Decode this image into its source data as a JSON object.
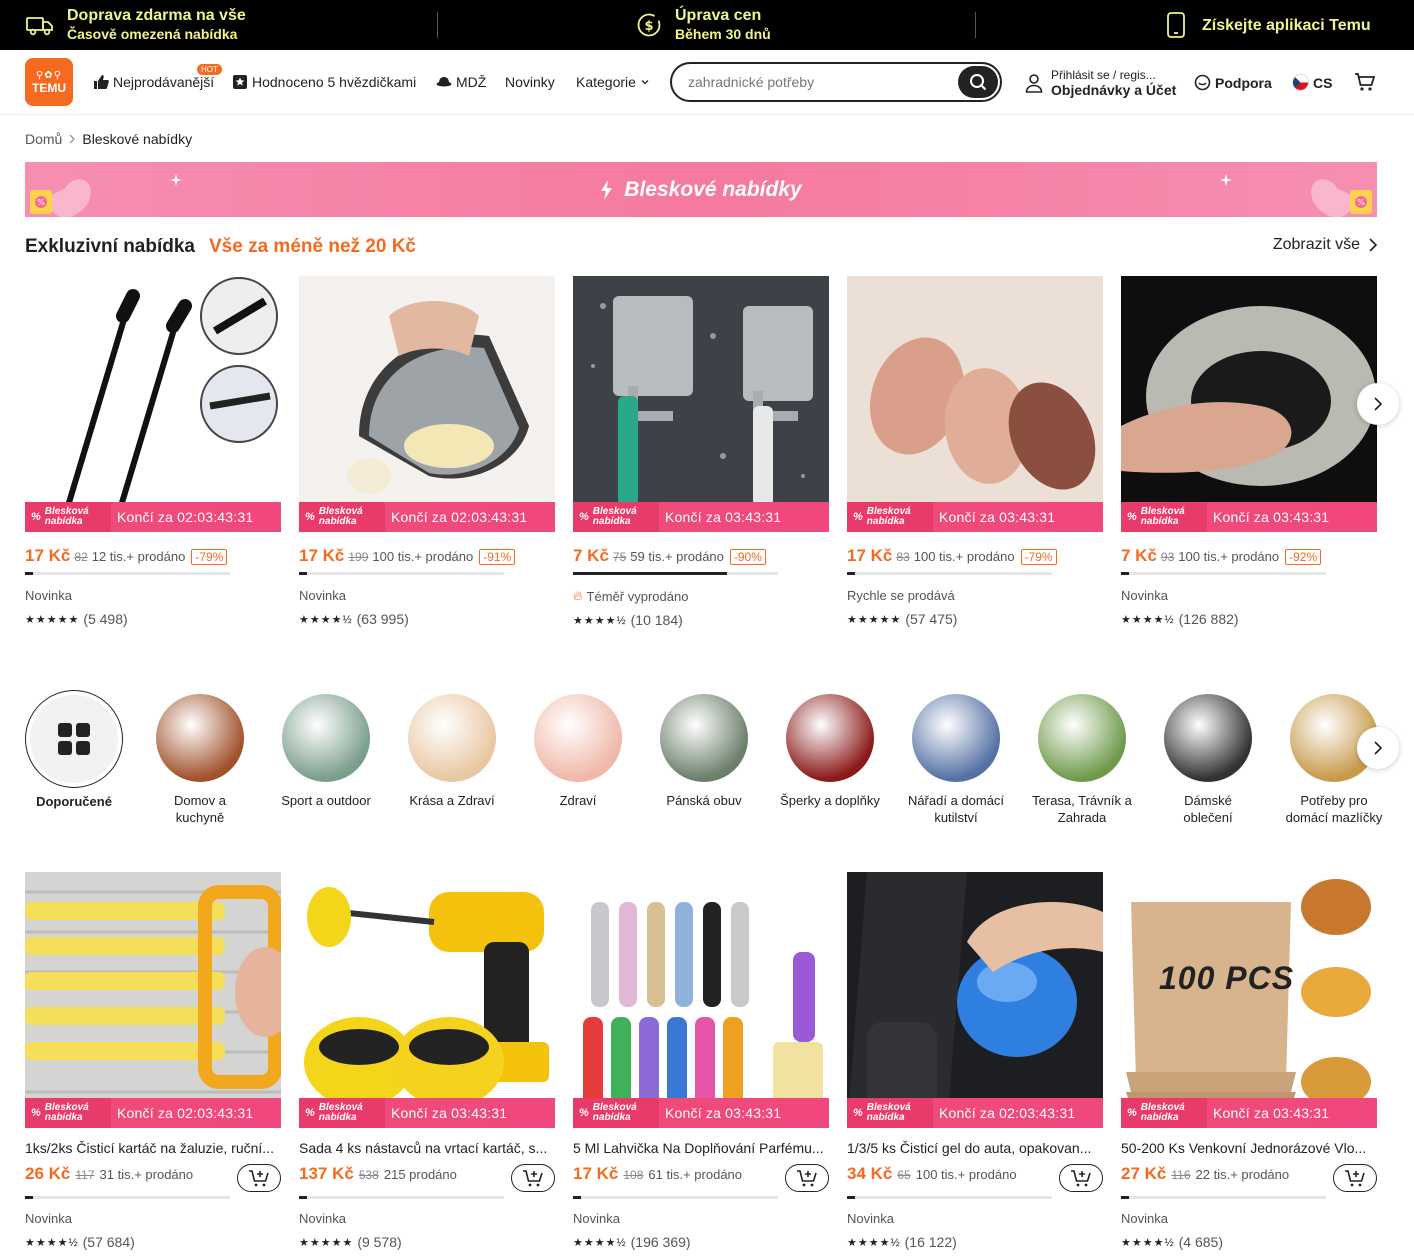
{
  "promo": {
    "shipping_title": "Doprava zdarma na vše",
    "shipping_sub": "Časově omezená nabídka",
    "price_title": "Úprava cen",
    "price_sub": "Během 30 dnů",
    "app_label": "Získejte aplikaci Temu",
    "color": "#f0f58a"
  },
  "header": {
    "logo_text": "TEMU",
    "nav": {
      "bestsellers": "Nejprodávanější",
      "hot": "HOT",
      "five_star": "Hodnoceno 5 hvězdičkami",
      "mdz": "MDŽ",
      "news": "Novinky",
      "categories": "Kategorie"
    },
    "search_placeholder": "zahradnické potřeby",
    "account_l1": "Přihlásit se / regis...",
    "account_l2": "Objednávky a Účet",
    "support": "Podpora",
    "language": "CS"
  },
  "breadcrumb": {
    "home": "Domů",
    "current": "Bleskové nabídky"
  },
  "banner": {
    "title": "Bleskové nabídky"
  },
  "section": {
    "title": "Exkluzivní nabídka",
    "subtitle": "Vše za méně než 20 Kč",
    "view_all": "Zobrazit vše"
  },
  "flash_label": {
    "l1": "Blesková",
    "l2": "nabídka"
  },
  "deals": [
    {
      "timer": "Končí za 02:03:43:31",
      "price": "17 Kč",
      "old": "82",
      "sold": "12 tis.+ prodáno",
      "discount": "-79%",
      "progress": 0.04,
      "tag": "Novinka",
      "stars": "★★★★★",
      "reviews": "(5 498)"
    },
    {
      "timer": "Končí za 02:03:43:31",
      "price": "17 Kč",
      "old": "199",
      "sold": "100 tis.+ prodáno",
      "discount": "-91%",
      "progress": 0.04,
      "tag": "Novinka",
      "stars": "★★★★½",
      "reviews": "(63 995)"
    },
    {
      "timer": "Končí za 03:43:31",
      "price": "7 Kč",
      "old": "75",
      "sold": "59 tis.+ prodáno",
      "discount": "-90%",
      "progress": 0.75,
      "tag": "Téměř vyprodáno",
      "stars": "★★★★½",
      "reviews": "(10 184)"
    },
    {
      "timer": "Končí za 03:43:31",
      "price": "17 Kč",
      "old": "83",
      "sold": "100 tis.+ prodáno",
      "discount": "-79%",
      "progress": 0.04,
      "tag": "Rychle se prodává",
      "stars": "★★★★★",
      "reviews": "(57 475)"
    },
    {
      "timer": "Končí za 03:43:31",
      "price": "7 Kč",
      "old": "93",
      "sold": "100 tis.+ prodáno",
      "discount": "-92%",
      "progress": 0.04,
      "tag": "Novinka",
      "stars": "★★★★½",
      "reviews": "(126 882)"
    }
  ],
  "categories": [
    {
      "label": "Doporučené",
      "color": "#f2f2f2"
    },
    {
      "label": "Domov a kuchyně",
      "color": "#a0522d"
    },
    {
      "label": "Sport a outdoor",
      "color": "#7a9e8b"
    },
    {
      "label": "Krása a Zdraví",
      "color": "#e9c7a2"
    },
    {
      "label": "Zdraví",
      "color": "#f0b8a8"
    },
    {
      "label": "Pánská obuv",
      "color": "#6b7f6a"
    },
    {
      "label": "Šperky a doplňky",
      "color": "#8b1a1a"
    },
    {
      "label": "Nářadí a do­mácí kutilství",
      "color": "#5571a3"
    },
    {
      "label": "Terasa, Tráv­ník a Zahrada",
      "color": "#6e9a4a"
    },
    {
      "label": "Dámské oblečení",
      "color": "#333333"
    },
    {
      "label": "Potřeby pro domácí mazlíčky",
      "color": "#c79a4a"
    }
  ],
  "products": [
    {
      "timer": "Končí za 02:03:43:31",
      "title": "1ks/2ks Čisticí kartáč na žaluzie, ruční...",
      "price": "26 Kč",
      "old": "117",
      "sold": "31 tis.+ prodáno",
      "progress": 0.04,
      "tag": "Novinka",
      "stars": "★★★★½",
      "reviews": "(57 684)"
    },
    {
      "timer": "Končí za 03:43:31",
      "title": "Sada 4 ks nástavců na vrtací kartáč, s...",
      "price": "137 Kč",
      "old": "538",
      "sold": "215 prodáno",
      "progress": 0.04,
      "tag": "Novinka",
      "stars": "★★★★★",
      "reviews": "(9 578)"
    },
    {
      "timer": "Končí za 03:43:31",
      "title": "5 Ml Lahvička Na Doplňování Parfému...",
      "price": "17 Kč",
      "old": "108",
      "sold": "61 tis.+ prodáno",
      "progress": 0.04,
      "tag": "Novinka",
      "stars": "★★★★½",
      "reviews": "(196 369)"
    },
    {
      "timer": "Končí za 02:03:43:31",
      "title": "1/3/5 ks Čisticí gel do auta, opakovan...",
      "price": "34 Kč",
      "old": "65",
      "sold": "100 tis.+ prodáno",
      "progress": 0.04,
      "tag": "Novinka",
      "stars": "★★★★½",
      "reviews": "(16 122)"
    },
    {
      "timer": "Končí za 03:43:31",
      "title": "50-200 Ks Venkovní Jednorázové Vlo...",
      "price": "27 Kč",
      "old": "116",
      "sold": "22 tis.+ prodáno",
      "progress": 0.04,
      "tag": "Novinka",
      "stars": "★★★★½",
      "reviews": "(4 685)"
    }
  ],
  "product_image_text": "100 PCS"
}
